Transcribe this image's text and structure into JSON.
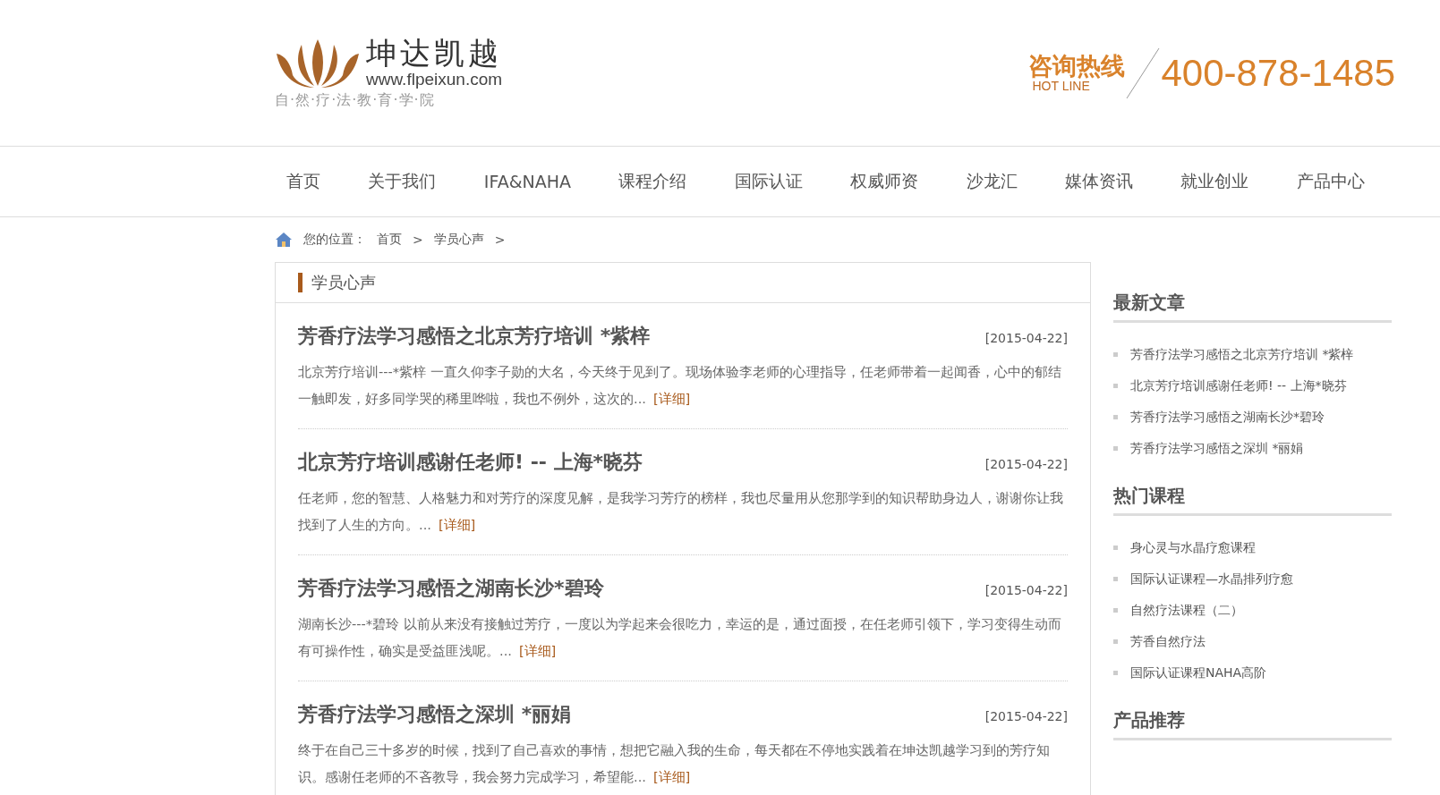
{
  "logo": {
    "name": "坤达凯越",
    "url": "www.flpeixun.com",
    "tagline": "自·然·疗·法·教·育·学·院"
  },
  "hotline": {
    "label": "咨询热线",
    "sublabel": "HOT LINE",
    "number": "400-878-1485"
  },
  "nav": [
    "首页",
    "关于我们",
    "IFA&NAHA",
    "课程介绍",
    "国际认证",
    "权威师资",
    "沙龙汇",
    "媒体资讯",
    "就业创业",
    "产品中心"
  ],
  "breadcrumb": {
    "label": "您的位置：",
    "items": [
      "首页",
      "学员心声"
    ],
    "separator": ">"
  },
  "section_title": "学员心声",
  "articles": [
    {
      "title": "芳香疗法学习感悟之北京芳疗培训 *紫梓",
      "date": "[2015-04-22]",
      "summary": "北京芳疗培训---*紫梓 一直久仰李子勋的大名，今天终于见到了。现场体验李老师的心理指导，任老师带着一起闻香，心中的郁结一触即发，好多同学哭的稀里哗啦，我也不例外，这次的...",
      "more": "[详细]"
    },
    {
      "title": "北京芳疗培训感谢任老师! -- 上海*晓芬",
      "date": "[2015-04-22]",
      "summary": "任老师，您的智慧、人格魅力和对芳疗的深度见解，是我学习芳疗的榜样，我也尽量用从您那学到的知识帮助身边人，谢谢你让我找到了人生的方向。...",
      "more": "[详细]"
    },
    {
      "title": "芳香疗法学习感悟之湖南长沙*碧玲",
      "date": "[2015-04-22]",
      "summary": "湖南长沙---*碧玲 以前从来没有接触过芳疗，一度以为学起来会很吃力，幸运的是，通过面授，在任老师引领下，学习变得生动而有可操作性，确实是受益匪浅呢。...",
      "more": "[详细]"
    },
    {
      "title": "芳香疗法学习感悟之深圳 *丽娟",
      "date": "[2015-04-22]",
      "summary": "终于在自己三十多岁的时候，找到了自己喜欢的事情，想把它融入我的生命，每天都在不停地实践着在坤达凯越学习到的芳疗知识。感谢任老师的不吝教导，我会努力完成学习，希望能...",
      "more": "[详细]"
    }
  ],
  "sidebar": [
    {
      "heading": "最新文章",
      "items": [
        "芳香疗法学习感悟之北京芳疗培训 *紫梓",
        "北京芳疗培训感谢任老师! -- 上海*晓芬",
        "芳香疗法学习感悟之湖南长沙*碧玲",
        "芳香疗法学习感悟之深圳 *丽娟"
      ]
    },
    {
      "heading": "热门课程",
      "items": [
        "身心灵与水晶疗愈课程",
        "国际认证课程—水晶排列疗愈",
        "自然疗法课程（二）",
        "芳香自然疗法",
        "国际认证课程NAHA高阶"
      ]
    },
    {
      "heading": "产品推荐"
    }
  ]
}
